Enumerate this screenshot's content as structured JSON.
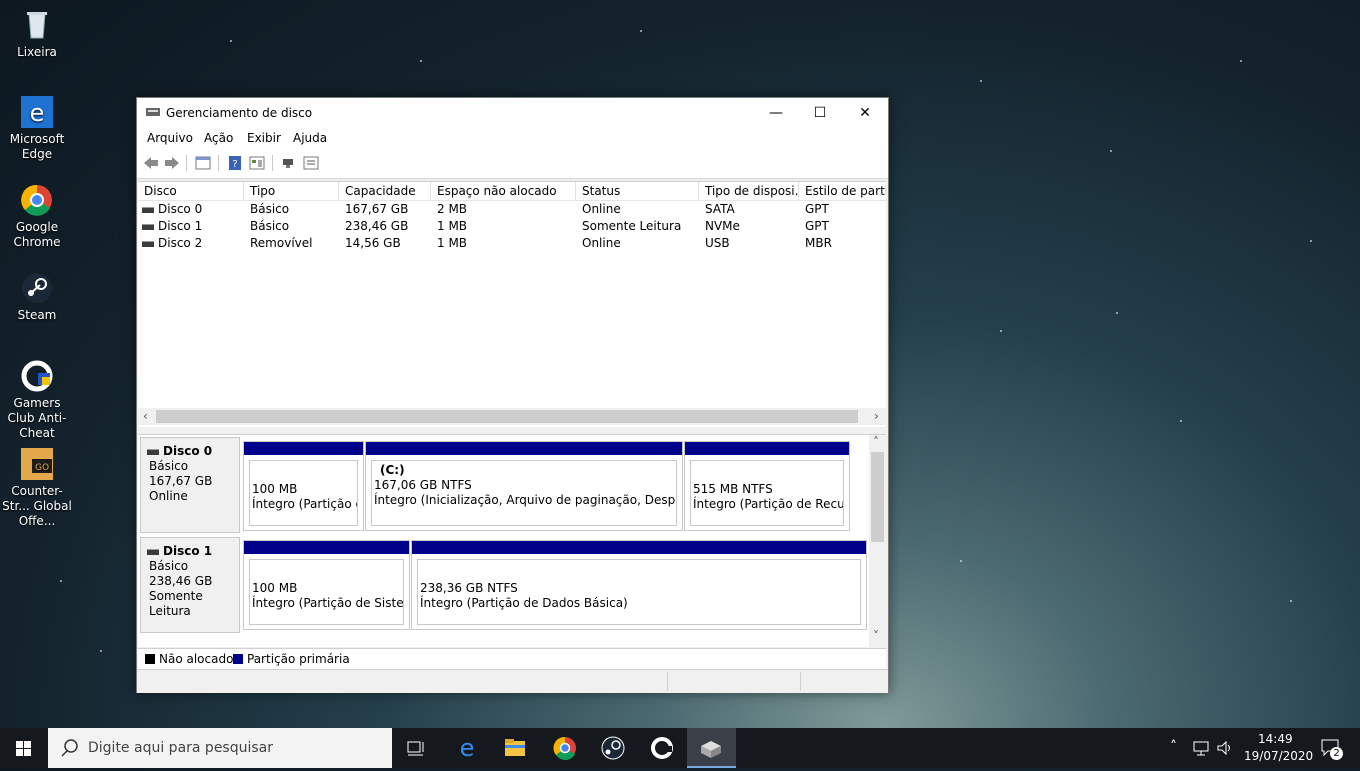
{
  "desktop": {
    "icons": [
      {
        "label": "Lixeira",
        "icon": "recycle-bin-icon"
      },
      {
        "label": "Microsoft Edge",
        "icon": "edge-icon"
      },
      {
        "label": "Google Chrome",
        "icon": "chrome-icon"
      },
      {
        "label": "Steam",
        "icon": "steam-icon"
      },
      {
        "label": "Gamers Club Anti-Cheat",
        "icon": "gamers-club-icon"
      },
      {
        "label": "Counter-Str... Global Offe...",
        "icon": "csgo-icon"
      }
    ]
  },
  "window": {
    "title": "Gerenciamento de disco",
    "menu": [
      "Arquivo",
      "Ação",
      "Exibir",
      "Ajuda"
    ],
    "controls": {
      "minimize": "—",
      "maximize": "☐",
      "close": "✕"
    }
  },
  "list": {
    "columns": [
      "Disco",
      "Tipo",
      "Capacidade",
      "Espaço não alocado",
      "Status",
      "Tipo de disposi...",
      "Estilo de partiç..."
    ],
    "rows": [
      [
        "Disco 0",
        "Básico",
        "167,67 GB",
        "2 MB",
        "Online",
        "SATA",
        "GPT"
      ],
      [
        "Disco 1",
        "Básico",
        "238,46 GB",
        "1 MB",
        "Somente Leitura",
        "NVMe",
        "GPT"
      ],
      [
        "Disco 2",
        "Removível",
        "14,56 GB",
        "1 MB",
        "Online",
        "USB",
        "MBR"
      ]
    ]
  },
  "graph": {
    "disks": [
      {
        "name": "Disco 0",
        "type": "Básico",
        "size": "167,67 GB",
        "status": "Online",
        "partitions": [
          {
            "line1": "",
            "line2": "100 MB",
            "line3": "Íntegro (Partição de"
          },
          {
            "line1": "(C:)",
            "line2": "167,06 GB NTFS",
            "line3": "Íntegro (Inicialização, Arquivo de paginação, Despejo de r"
          },
          {
            "line1": "",
            "line2": "515 MB NTFS",
            "line3": "Íntegro (Partição de Recuper"
          }
        ]
      },
      {
        "name": "Disco 1",
        "type": "Básico",
        "size": "238,46 GB",
        "status": "Somente Leitura",
        "partitions": [
          {
            "line1": "",
            "line2": "100 MB",
            "line3": "Íntegro (Partição de Sistema I"
          },
          {
            "line1": "",
            "line2": "238,36 GB NTFS",
            "line3": "Íntegro (Partição de Dados Básica)"
          }
        ]
      }
    ]
  },
  "legend": {
    "unallocated": {
      "label": "Não alocado",
      "color": "#000000"
    },
    "primary": {
      "label": "Partição primária",
      "color": "#00008b"
    }
  },
  "taskbar": {
    "search_placeholder": "Digite aqui para pesquisar",
    "time": "14:49",
    "date": "19/07/2020",
    "notifications": "2"
  }
}
